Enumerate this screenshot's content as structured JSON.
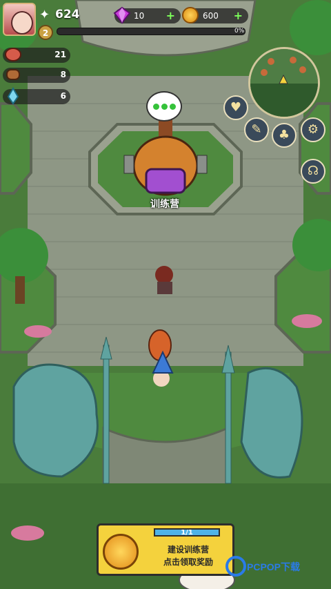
{
  "hud": {
    "power": "624",
    "level": "2",
    "xp_percent_label": "0%",
    "xp_fraction": 0,
    "gems": "10",
    "coins": "600",
    "plus_gems": "+",
    "plus_coins": "+"
  },
  "resources": [
    {
      "icon": "meat-icon",
      "value": "21"
    },
    {
      "icon": "wood-icon",
      "value": "8"
    },
    {
      "icon": "crystal-icon",
      "value": "6"
    }
  ],
  "building": {
    "name": "训练营"
  },
  "quest": {
    "progress": "1/1",
    "line1": "建设训练营",
    "line2": "点击领取奖励"
  },
  "watermark": {
    "text": "PCPOP下载"
  },
  "colors": {
    "stone": "#8b9480",
    "grass": "#4e8a3e",
    "quest_bg": "#f4d23d",
    "gem": "#c23ad6",
    "coin": "#f2a81d"
  }
}
